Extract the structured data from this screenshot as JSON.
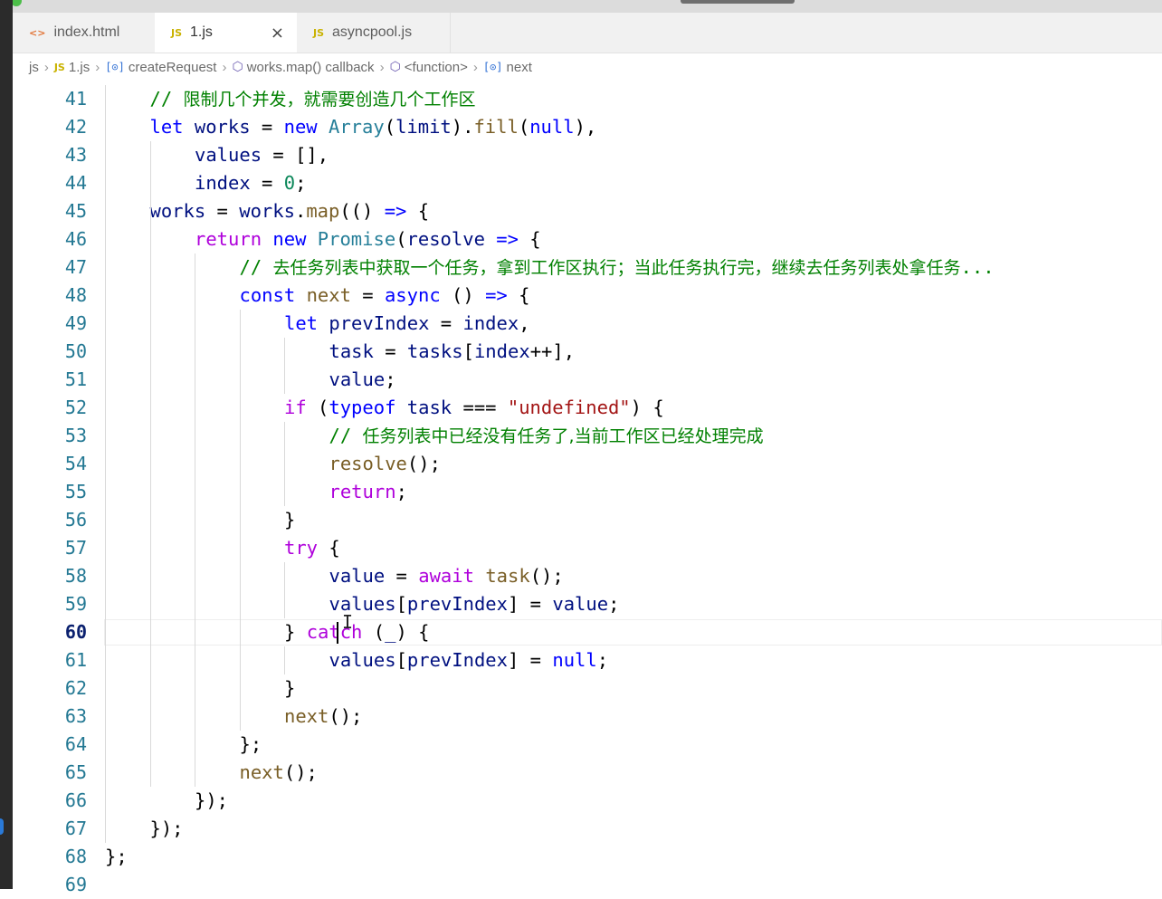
{
  "tabs": [
    {
      "icon": "<>",
      "label": "index.html",
      "active": false
    },
    {
      "icon": "JS",
      "label": "1.js",
      "active": true,
      "close": "×"
    },
    {
      "icon": "JS",
      "label": "asyncpool.js",
      "active": false
    }
  ],
  "breadcrumb": {
    "folder": "js",
    "file_icon": "JS",
    "file": "1.js",
    "var_icon": "[⊙]",
    "function": "createRequest",
    "cube_icon": "⬡",
    "callback": "works.map() callback",
    "anon": "<function>",
    "symbol": "next"
  },
  "colors": {
    "keyword": "#0000ff",
    "control": "#af00db",
    "string": "#a31515",
    "number": "#098658",
    "comment": "#008000",
    "variable": "#001080",
    "function": "#795e26",
    "type": "#267f99",
    "line_number": "#237893"
  },
  "editor": {
    "current_line": 60,
    "lines": [
      {
        "n": "41",
        "indent": 1,
        "tokens": [
          [
            "cm",
            "// "
          ],
          [
            "cmcn",
            "限制几个并发，就需要创造几个工作区"
          ]
        ]
      },
      {
        "n": "42",
        "indent": 1,
        "tokens": [
          [
            "kw",
            "let"
          ],
          [
            "op",
            " "
          ],
          [
            "vr",
            "works"
          ],
          [
            "op",
            " = "
          ],
          [
            "kw",
            "new"
          ],
          [
            "op",
            " "
          ],
          [
            "ty",
            "Array"
          ],
          [
            "op",
            "("
          ],
          [
            "vr",
            "limit"
          ],
          [
            "op",
            ")."
          ],
          [
            "fn",
            "fill"
          ],
          [
            "op",
            "("
          ],
          [
            "kw",
            "null"
          ],
          [
            "op",
            "),"
          ]
        ]
      },
      {
        "n": "43",
        "indent": 2,
        "tokens": [
          [
            "vr",
            "values"
          ],
          [
            "op",
            " = [],"
          ]
        ]
      },
      {
        "n": "44",
        "indent": 2,
        "tokens": [
          [
            "vr",
            "index"
          ],
          [
            "op",
            " = "
          ],
          [
            "num",
            "0"
          ],
          [
            "op",
            ";"
          ]
        ]
      },
      {
        "n": "45",
        "indent": 1,
        "tokens": [
          [
            "vr",
            "works"
          ],
          [
            "op",
            " = "
          ],
          [
            "vr",
            "works"
          ],
          [
            "op",
            "."
          ],
          [
            "fn",
            "map"
          ],
          [
            "op",
            "(() "
          ],
          [
            "kw",
            "=>"
          ],
          [
            "op",
            " {"
          ]
        ]
      },
      {
        "n": "46",
        "indent": 2,
        "tokens": [
          [
            "ctl",
            "return"
          ],
          [
            "op",
            " "
          ],
          [
            "kw",
            "new"
          ],
          [
            "op",
            " "
          ],
          [
            "ty",
            "Promise"
          ],
          [
            "op",
            "("
          ],
          [
            "vr",
            "resolve"
          ],
          [
            "op",
            " "
          ],
          [
            "kw",
            "=>"
          ],
          [
            "op",
            " {"
          ]
        ]
      },
      {
        "n": "47",
        "indent": 3,
        "tokens": [
          [
            "cm",
            "// "
          ],
          [
            "cmcn",
            "去任务列表中获取一个任务，拿到工作区执行；当此任务执行完，继续去任务列表处拿任务"
          ],
          [
            "cm",
            "..."
          ]
        ]
      },
      {
        "n": "48",
        "indent": 3,
        "tokens": [
          [
            "kw",
            "const"
          ],
          [
            "op",
            " "
          ],
          [
            "fn",
            "next"
          ],
          [
            "op",
            " = "
          ],
          [
            "kw",
            "async"
          ],
          [
            "op",
            " () "
          ],
          [
            "kw",
            "=>"
          ],
          [
            "op",
            " {"
          ]
        ]
      },
      {
        "n": "49",
        "indent": 4,
        "tokens": [
          [
            "kw",
            "let"
          ],
          [
            "op",
            " "
          ],
          [
            "vr",
            "prevIndex"
          ],
          [
            "op",
            " = "
          ],
          [
            "vr",
            "index"
          ],
          [
            "op",
            ","
          ]
        ]
      },
      {
        "n": "50",
        "indent": 5,
        "tokens": [
          [
            "vr",
            "task"
          ],
          [
            "op",
            " = "
          ],
          [
            "vr",
            "tasks"
          ],
          [
            "op",
            "["
          ],
          [
            "vr",
            "index"
          ],
          [
            "op",
            "++],"
          ]
        ]
      },
      {
        "n": "51",
        "indent": 5,
        "tokens": [
          [
            "vr",
            "value"
          ],
          [
            "op",
            ";"
          ]
        ]
      },
      {
        "n": "52",
        "indent": 4,
        "tokens": [
          [
            "ctl",
            "if"
          ],
          [
            "op",
            " ("
          ],
          [
            "kw",
            "typeof"
          ],
          [
            "op",
            " "
          ],
          [
            "vr",
            "task"
          ],
          [
            "op",
            " === "
          ],
          [
            "str",
            "\"undefined\""
          ],
          [
            "op",
            ") {"
          ]
        ]
      },
      {
        "n": "53",
        "indent": 5,
        "tokens": [
          [
            "cm",
            "// "
          ],
          [
            "cmcn",
            "任务列表中已经没有任务了,当前工作区已经处理完成"
          ]
        ]
      },
      {
        "n": "54",
        "indent": 5,
        "tokens": [
          [
            "fn",
            "resolve"
          ],
          [
            "op",
            "();"
          ]
        ]
      },
      {
        "n": "55",
        "indent": 5,
        "tokens": [
          [
            "ctl",
            "return"
          ],
          [
            "op",
            ";"
          ]
        ]
      },
      {
        "n": "56",
        "indent": 4,
        "tokens": [
          [
            "op",
            "}"
          ]
        ]
      },
      {
        "n": "57",
        "indent": 4,
        "tokens": [
          [
            "ctl",
            "try"
          ],
          [
            "op",
            " {"
          ]
        ]
      },
      {
        "n": "58",
        "indent": 5,
        "tokens": [
          [
            "vr",
            "value"
          ],
          [
            "op",
            " = "
          ],
          [
            "ctl",
            "await"
          ],
          [
            "op",
            " "
          ],
          [
            "fn",
            "task"
          ],
          [
            "op",
            "();"
          ]
        ]
      },
      {
        "n": "59",
        "indent": 5,
        "tokens": [
          [
            "vr",
            "values"
          ],
          [
            "op",
            "["
          ],
          [
            "vr",
            "prevIndex"
          ],
          [
            "op",
            "] = "
          ],
          [
            "vr",
            "value"
          ],
          [
            "op",
            ";"
          ]
        ]
      },
      {
        "n": "60",
        "indent": 4,
        "tokens": [
          [
            "op",
            "} "
          ],
          [
            "ctl",
            "catch"
          ],
          [
            "op",
            " ("
          ],
          [
            "vr",
            "_"
          ],
          [
            "op",
            ") {"
          ]
        ]
      },
      {
        "n": "61",
        "indent": 5,
        "tokens": [
          [
            "vr",
            "values"
          ],
          [
            "op",
            "["
          ],
          [
            "vr",
            "prevIndex"
          ],
          [
            "op",
            "] = "
          ],
          [
            "kw",
            "null"
          ],
          [
            "op",
            ";"
          ]
        ]
      },
      {
        "n": "62",
        "indent": 4,
        "tokens": [
          [
            "op",
            "}"
          ]
        ]
      },
      {
        "n": "63",
        "indent": 4,
        "tokens": [
          [
            "fn",
            "next"
          ],
          [
            "op",
            "();"
          ]
        ]
      },
      {
        "n": "64",
        "indent": 3,
        "tokens": [
          [
            "op",
            "};"
          ]
        ]
      },
      {
        "n": "65",
        "indent": 3,
        "tokens": [
          [
            "fn",
            "next"
          ],
          [
            "op",
            "();"
          ]
        ]
      },
      {
        "n": "66",
        "indent": 2,
        "tokens": [
          [
            "op",
            "});"
          ]
        ]
      },
      {
        "n": "67",
        "indent": 1,
        "tokens": [
          [
            "op",
            "});"
          ]
        ]
      },
      {
        "n": "68",
        "indent": 0,
        "tokens": [
          [
            "op",
            "};"
          ]
        ]
      },
      {
        "n": "69",
        "indent": 0,
        "tokens": []
      }
    ]
  }
}
